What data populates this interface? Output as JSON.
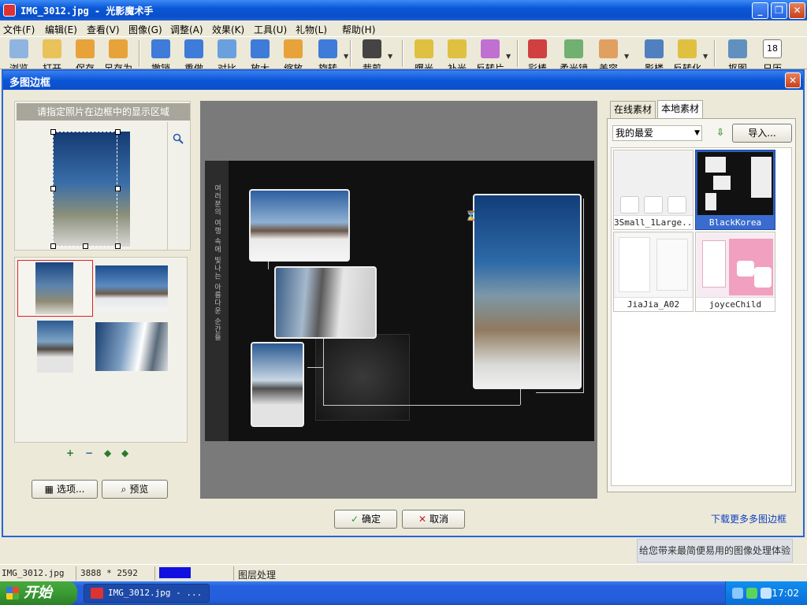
{
  "window": {
    "title": "IMG_3012.jpg - 光影魔术手",
    "minimize_label": "_",
    "maximize_label": "❐",
    "close_label": "✕"
  },
  "menu": [
    "文件(F)",
    "编辑(E)",
    "查看(V)",
    "图像(G)",
    "调整(A)",
    "效果(K)",
    "工具(U)",
    "礼物(L)",
    "帮助(H)"
  ],
  "toolbar": [
    {
      "label": "浏览",
      "icon": "eye-icon",
      "color": "#8fb4e0"
    },
    {
      "label": "打开",
      "icon": "folder-icon",
      "color": "#e9c25a"
    },
    {
      "label": "保存",
      "icon": "save-icon",
      "color": "#e8a23a"
    },
    {
      "label": "另存为",
      "icon": "save-as-icon",
      "color": "#e8a23a"
    },
    {
      "label": "撤销",
      "icon": "undo-icon",
      "color": "#3f7bd8"
    },
    {
      "label": "重做",
      "icon": "redo-icon",
      "color": "#3f7bd8"
    },
    {
      "label": "对比",
      "icon": "compare-icon",
      "color": "#6aa0de"
    },
    {
      "label": "放大",
      "icon": "zoom-in-icon",
      "color": "#3f7bd8"
    },
    {
      "label": "缩放",
      "icon": "resize-icon",
      "color": "#e8a23a"
    },
    {
      "label": "旋转",
      "icon": "rotate-icon",
      "color": "#3f7bd8"
    },
    {
      "label": "裁剪",
      "icon": "crop-icon",
      "color": "#444"
    },
    {
      "label": "曝光",
      "icon": "exposure-icon",
      "color": "#e0c040"
    },
    {
      "label": "补光",
      "icon": "fill-light-icon",
      "color": "#e0c040"
    },
    {
      "label": "反转片",
      "icon": "slide-film-icon",
      "color": "#c070d0"
    },
    {
      "label": "彩棒",
      "icon": "color-wand-icon",
      "color": "#d04040"
    },
    {
      "label": "柔光镜",
      "icon": "soft-filter-icon",
      "color": "#70b070"
    },
    {
      "label": "美容",
      "icon": "beauty-icon",
      "color": "#e0a060"
    },
    {
      "label": "影楼",
      "icon": "studio-icon",
      "color": "#5080c0"
    },
    {
      "label": "反转化",
      "icon": "invert-icon",
      "color": "#e0c040"
    },
    {
      "label": "抠图",
      "icon": "cutout-icon",
      "color": "#6090c0"
    },
    {
      "label": "日历",
      "icon": "calendar-icon",
      "color": "#40a040"
    }
  ],
  "calendar_day": "18",
  "dialog": {
    "title": "多图边框",
    "close_label": "✕",
    "area_hint": "请指定照片在边框中的显示区域",
    "ops": {
      "add": "+",
      "remove": "−",
      "prev": "◆",
      "next": "◆"
    },
    "options_label": "选项...",
    "preview_label": "预览",
    "ok_label": "确定",
    "cancel_label": "取消",
    "tabs": [
      "在线素材",
      "本地素材"
    ],
    "category_select": "我的最爱",
    "import_label": "导入...",
    "materials": [
      "3Small_1Large...",
      "BlackKorea",
      "JiaJia_A02",
      "joyceChild"
    ],
    "more_link": "下载更多多图边框",
    "frame_vertical_text": "여러분의 여행 속에 빛나는 아름다운 순간들"
  },
  "hint": "给您带来最简便易用的图像处理体验",
  "status": {
    "filename": "IMG_3012.jpg",
    "dimensions": "3888 * 2592",
    "mode": "图层处理"
  },
  "taskbar": {
    "start_label": "开始",
    "task_label": "IMG_3012.jpg - ...",
    "time": "17:02"
  }
}
